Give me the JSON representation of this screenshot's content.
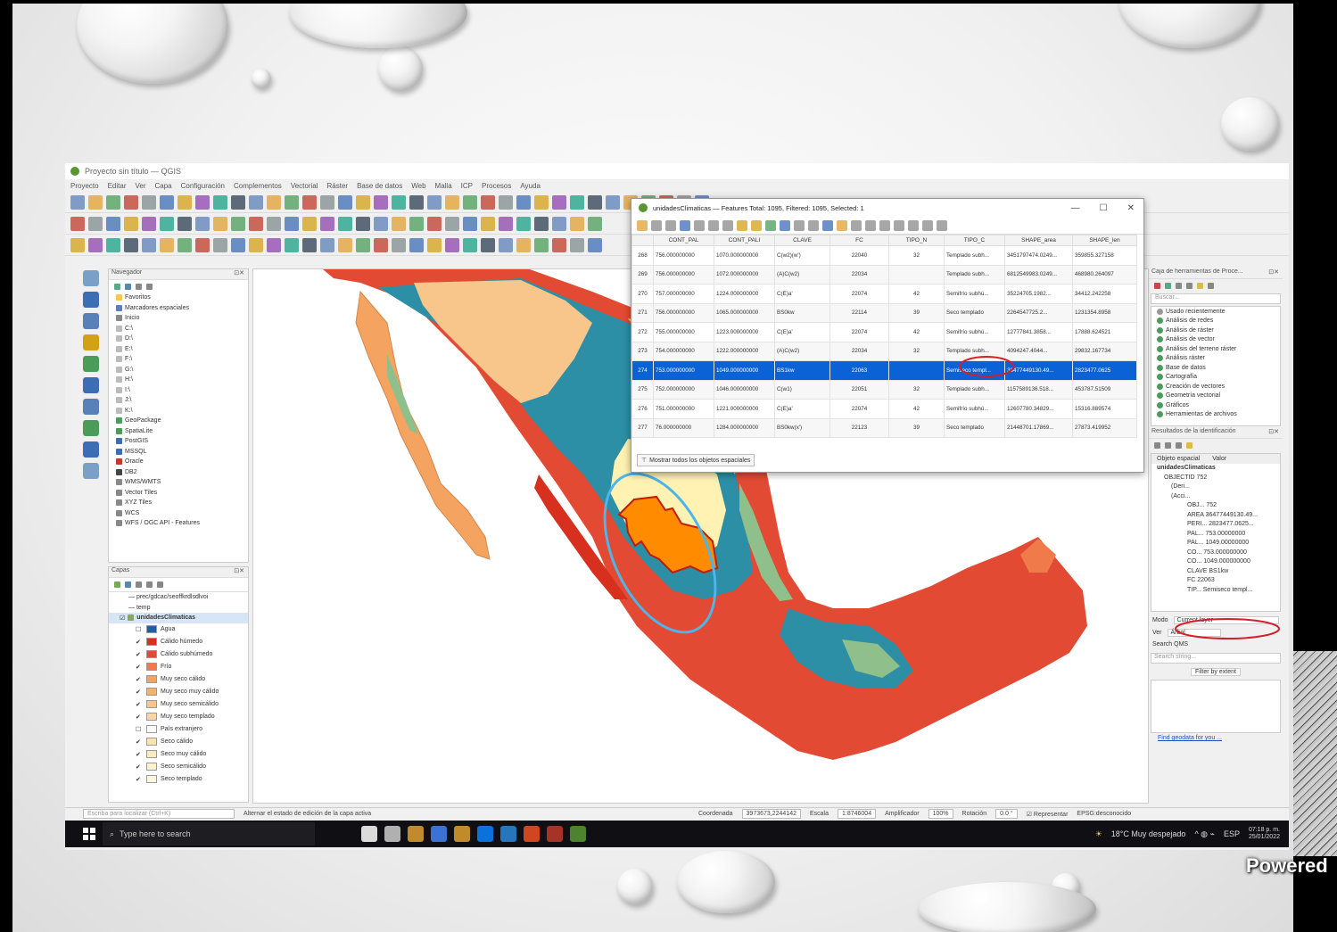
{
  "app": {
    "title": "Proyecto sin título — QGIS",
    "menu": [
      "Proyecto",
      "Editar",
      "Ver",
      "Capa",
      "Configuración",
      "Complementos",
      "Vectorial",
      "Ráster",
      "Base de datos",
      "Web",
      "Malla",
      "ICP",
      "Procesos",
      "Ayuda"
    ]
  },
  "navigator": {
    "header": "Navegador",
    "items": [
      "Favoritos",
      "Marcadores espaciales",
      "Inicio",
      "C:\\",
      "D:\\",
      "E:\\",
      "F:\\",
      "G:\\",
      "H:\\",
      "I:\\",
      "J:\\",
      "K:\\",
      "GeoPackage",
      "SpatiaLite",
      "PostGIS",
      "MSSQL",
      "Oracle",
      "DB2",
      "WMS/WMTS",
      "Vector Tiles",
      "XYZ Tiles",
      "WCS",
      "WFS / OGC API - Features"
    ]
  },
  "layers": {
    "header": "Capas",
    "paths": [
      "— prec/gdcac/seoffkrdlsdlvoi",
      "— temp"
    ],
    "group": "unidadesClimaticas",
    "legend": [
      {
        "label": "Agua",
        "color": "#1f5fa8",
        "checked": false
      },
      {
        "label": "Cálido húmedo",
        "color": "#d7301f",
        "checked": true
      },
      {
        "label": "Cálido subhúmedo",
        "color": "#e34a33",
        "checked": true
      },
      {
        "label": "Frío",
        "color": "#f07a4a",
        "checked": true
      },
      {
        "label": "Muy seco cálido",
        "color": "#f4a460",
        "checked": true
      },
      {
        "label": "Muy seco muy cálido",
        "color": "#f6b26b",
        "checked": true
      },
      {
        "label": "Muy seco semicálido",
        "color": "#f8c68a",
        "checked": true
      },
      {
        "label": "Muy seco templado",
        "color": "#fad7a0",
        "checked": true
      },
      {
        "label": "País extranjero",
        "color": "#ffffff",
        "checked": false
      },
      {
        "label": "Seco cálido",
        "color": "#fbe3b0",
        "checked": true
      },
      {
        "label": "Seco muy cálido",
        "color": "#fcebc0",
        "checked": true
      },
      {
        "label": "Seco semicálido",
        "color": "#fdf3d0",
        "checked": true
      },
      {
        "label": "Seco templado",
        "color": "#fff8dc",
        "checked": true
      }
    ]
  },
  "attribute_table": {
    "title": "unidadesClimaticas — Features Total: 1095, Filtered: 1095, Selected: 1",
    "columns": [
      "",
      "CONT_PAL",
      "CONT_PALI",
      "CLAVE",
      "FC",
      "TIPO_N",
      "TIPO_C",
      "SHAPE_area",
      "SHAPE_len"
    ],
    "rows": [
      [
        "268",
        "756.000000000",
        "1070.000000000",
        "C(w2)(w')",
        "22040",
        "32",
        "Templado subh...",
        "3451797474.0249...",
        "359855.327158"
      ],
      [
        "269",
        "756.000000000",
        "1072.000000000",
        "(A)C(w2)",
        "22034",
        "",
        "Templado subh...",
        "6812549983.0249...",
        "468980.264097"
      ],
      [
        "270",
        "757.000000000",
        "1224.000000000",
        "C(E)a'",
        "22074",
        "42",
        "Semifrío subhú...",
        "35224705.1982...",
        "34412.242258"
      ],
      [
        "271",
        "756.000000000",
        "1065.000000000",
        "BS0kw",
        "22114",
        "39",
        "Seco templado",
        "2264547725.2...",
        "1231354.8958"
      ],
      [
        "272",
        "755.000000000",
        "1223.000000000",
        "C(E)a'",
        "22074",
        "42",
        "Semifrío subhú...",
        "12777841.3858...",
        "17888.624521"
      ],
      [
        "273",
        "754.000000000",
        "1222.000000000",
        "(A)C(w2)",
        "22034",
        "32",
        "Templado subh...",
        "4094247.4044...",
        "29832.167734"
      ],
      [
        "274",
        "753.000000000",
        "1049.000000000",
        "BS1kw",
        "22063",
        "",
        "Semiseco templ...",
        "36477449130.49...",
        "2823477.0625"
      ],
      [
        "275",
        "752.000000000",
        "1046.000000000",
        "C(w1)",
        "22051",
        "32",
        "Templado subh...",
        "1157589136.518...",
        "453787.51509"
      ],
      [
        "276",
        "751.000000000",
        "1221.000000000",
        "C(E)a'",
        "22074",
        "42",
        "Semifrío subhú...",
        "12607780.34829...",
        "15316.889574"
      ],
      [
        "277",
        "76.000000000",
        "1284.000000000",
        "BS0kw(x')",
        "22123",
        "39",
        "Seco templado",
        "21448701.17869...",
        "27873.419952"
      ]
    ],
    "selected_row": 6,
    "footer_label": "Mostrar todos los objetos espaciales"
  },
  "right_panel": {
    "toolbox_header": "Caja de herramientas de Proce...",
    "search_placeholder": "Buscar...",
    "toolbox_items": [
      "Usado recientemente",
      "Análisis de redes",
      "Análisis de ráster",
      "Análisis de vector",
      "Análisis del terreno ráster",
      "Análisis ráster",
      "Base de datos",
      "Cartografía",
      "Creación de vectores",
      "Geometría vectorial",
      "Gráficos",
      "Herramientas de archivos"
    ],
    "identify_header": "Resultados de la identificación",
    "identify_cols": [
      "Objeto espacial",
      "Valor"
    ],
    "identify_tree": [
      "unidadesClimaticas",
      "OBJECTID  752",
      "(Deri...",
      "(Acci...",
      "OBJ...  752",
      "AREA  36477449130.49...",
      "PERI...  2823477.0625...",
      "PAL...  753.00000000",
      "PAL...  1049.00000000",
      "CO...  753.000000000",
      "CO...  1049.000000000",
      "CLAVE  BS1kw",
      "FC  22063",
      "TIP...  Semiseco templ..."
    ],
    "mode_label": "Modo",
    "mode_value": "Current layer",
    "view_label": "Ver",
    "view_value": "Árbol",
    "search_qms_label": "Search QMS",
    "search_string_placeholder": "Search string...",
    "filter_label": "Filter by extent",
    "footer_link": "Find geodata for you ..."
  },
  "statusbar": {
    "locator_placeholder": "Escriba para localizar (Ctrl+K)",
    "message": "Alternar el estado de edición de la capa activa",
    "coord_label": "Coordenada",
    "coord_value": "3973673,2244142",
    "scale_label": "Escala",
    "scale_value": "1:8746004",
    "magnifier_label": "Amplificador",
    "magnifier_value": "100%",
    "rotation_label": "Rotación",
    "rotation_value": "0.0 °",
    "render_label": "Representar",
    "crs_label": "EPSG:desconocido"
  },
  "taskbar": {
    "search_placeholder": "Type here to search",
    "weather": "18°C  Muy despejado",
    "lang": "ESP",
    "time": "07:18 p. m.",
    "date": "25/01/2022"
  },
  "overlay": {
    "powered": "Powered"
  }
}
